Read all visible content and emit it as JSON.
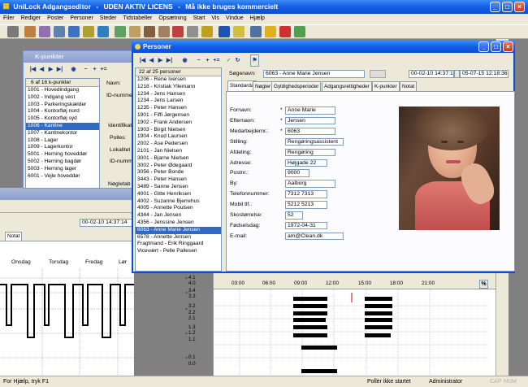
{
  "app": {
    "title": "UniLock Adgangseditor",
    "license": "UDEN AKTIV LICENS",
    "warning": "Må ikke bruges kommercielt"
  },
  "menu": [
    "Filer",
    "Rediger",
    "Poster",
    "Personer",
    "Steder",
    "Tidstabeller",
    "Opsætning",
    "Start",
    "Vis",
    "Vindue",
    "Hjælp"
  ],
  "kpunkter": {
    "title": "K-punkter",
    "count_label": "6  af  16  k-punkter",
    "items": [
      "1001 - Hovedindgang",
      "1002 - Indgang vest",
      "1003 - Parkeringskælder",
      "1004 - Kontorfløj nord",
      "1005 - Kontorfløj syd",
      "1006 - Kantine",
      "1007 - Kantinekontor",
      "1008 - Lager",
      "1009 - Lagerkontor",
      "5001 - Herning hoveddør",
      "5002 - Herning bagdør",
      "5003 - Herning lager",
      "6001 - Vejle hoveddør"
    ],
    "selected": 5,
    "navn_label": "Navn:",
    "idnumber_label": "ID-nummer",
    "group_label": "Identifikat",
    "field1": "Polles:",
    "field2": "Lokalitet",
    "field3": "ID-numm",
    "keys_label": "Nøgletab"
  },
  "back_window": {
    "timestamp": "00-02-10  14:37:14",
    "tab": "Notat",
    "days": [
      "Onsdag",
      "Torsdag",
      "Fredag",
      "Lør"
    ],
    "axis": [
      "4.1",
      "4.0",
      "3.4",
      "3.3",
      "3.2",
      "2.2",
      "2.1",
      "1.3",
      "1.2",
      "1.1",
      "0.1",
      "0.0"
    ]
  },
  "personer": {
    "title": "Personer",
    "count_label": "22  af  25  personer",
    "list": [
      "1206 - Rene Iversen",
      "1218 - Kristiak Yllemann",
      "1234 - Jens Hansen",
      "1234 - Jens Larsen",
      "1235 - Peter Hansen",
      "1901 - Fiffi Jørgensen",
      "1902 - Frank Andersen",
      "1903 - Birgit Nielsen",
      "1904 - Knud Laursen",
      "2002 - Åse Pedersen",
      "2101 - Jan Nielsen",
      "3001 - Bjarne Nielsen",
      "3002 - Peter Ødegaard",
      "3056 - Peter Bonde",
      "3443 - Peter Hansen",
      "3489 - Sanne Jensen",
      "4001 - Gitte Henriksen",
      "4002 - Suzanne Bjerrehus",
      "4005 - Annette Poulsen",
      "4344 - Jan Jensen",
      "4356 - Jenssine Jensen",
      "6063 - Anne Marie Jensen",
      "6578 - Annette Jensen",
      "Fragtmand - Erik Ringgaard",
      "Vicevært - Pelle Pallesen"
    ],
    "selected": 21,
    "search_label": "Søgenavn:",
    "search_value": "6063 - Anne Marie Jensen",
    "ts1": "00-02-10  14:37:16",
    "ts2": "05-07-15  12:18:36",
    "tabs": [
      "Standarda",
      "Nøgler",
      "Gyldighedsperioder",
      "Adgangsrettigheder",
      "K-punkter",
      "Notat"
    ],
    "fields": [
      {
        "label": "Fornavn:",
        "value": "Anne Marie",
        "req": "*"
      },
      {
        "label": "Efternavn:",
        "value": "Jensen",
        "req": "*"
      },
      {
        "label": "Medarbejdernr.:",
        "value": "6063",
        "req": "*"
      },
      {
        "label": "Stilling:",
        "value": "Rengøringsassistent",
        "req": ""
      },
      {
        "label": "Afdeling:",
        "value": "Rengøring",
        "req": ""
      },
      {
        "label": "Adresse:",
        "value": "Højgade 22",
        "req": ""
      },
      {
        "label": "Postnr.:",
        "value": "9000",
        "req": ""
      },
      {
        "label": "By:",
        "value": "Aalborg",
        "req": ""
      },
      {
        "label": "Telefonnummer:",
        "value": "7312 7313",
        "req": ""
      },
      {
        "label": "Mobil tlf.:",
        "value": "5212 5213",
        "req": ""
      },
      {
        "label": "Skostørrelse:",
        "value": "52",
        "req": ""
      },
      {
        "label": "Fødselsdag:",
        "value": "1972-04-31",
        "req": ""
      },
      {
        "label": "E-mail:",
        "value": "am@Clean.dk",
        "req": ""
      }
    ]
  },
  "schedule": {
    "hours": [
      "03:00",
      "06:00",
      "09:00",
      "12:00",
      "15:00",
      "18:00",
      "21:00"
    ],
    "zoom_icon": "%"
  },
  "status": {
    "help": "For Hjælp, tryk F1",
    "poller": "Poller ikke startet",
    "user": "Administrator",
    "caps": "CAP",
    "num": "NUM"
  }
}
